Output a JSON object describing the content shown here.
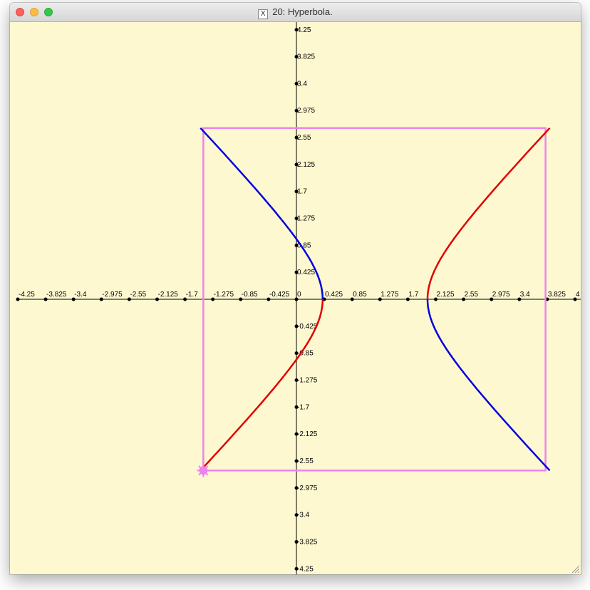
{
  "window": {
    "title": "20: Hyperbola.",
    "title_icon": "x11-icon"
  },
  "colors": {
    "background": "#fdf8d0",
    "axis": "#000000",
    "box": "#ee82ee",
    "curve_red": "#e00000",
    "curve_blue": "#0000e0"
  },
  "chart_data": {
    "type": "line",
    "xlim": [
      -4.25,
      4.25
    ],
    "ylim": [
      -4.25,
      4.25
    ],
    "x_ticks": [
      "-4.25",
      "-3.825",
      "-3.4",
      "-2.975",
      "-2.55",
      "-2.125",
      "-1.7",
      "-1.275",
      "-0.85",
      "-0.425",
      "0",
      "0.425",
      "0.85",
      "1.275",
      "1.7",
      "2.125",
      "2.55",
      "2.975",
      "3.4",
      "3.825",
      "4"
    ],
    "y_ticks": [
      "4.25",
      "3.825",
      "3.4",
      "2.975",
      "2.55",
      "2.125",
      "1.7",
      "1.275",
      "0.85",
      "0.425",
      "-0.425",
      "-0.85",
      "-1.275",
      "-1.7",
      "-2.125",
      "-2.55",
      "-2.975",
      "-3.4",
      "-3.825",
      "-4.25"
    ],
    "box": {
      "x": [
        -1.42,
        3.8
      ],
      "y": [
        -2.7,
        2.7
      ]
    },
    "hyperbola": {
      "center": [
        1.2,
        0
      ],
      "a": 0.8,
      "b": 0.85
    },
    "marker_point": [
      -1.42,
      -2.7
    ],
    "series": []
  }
}
